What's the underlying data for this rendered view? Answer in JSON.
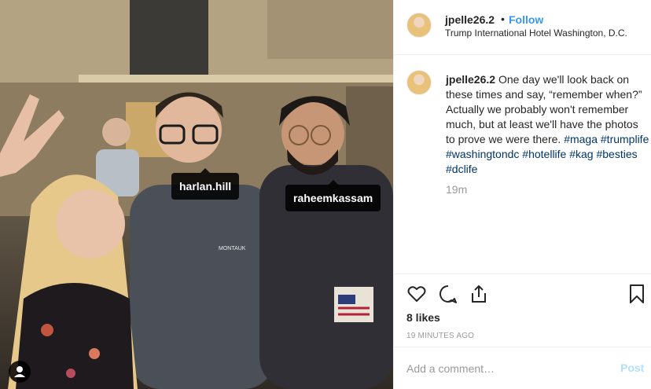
{
  "post": {
    "username": "jpelle26.2",
    "follow_label": "Follow",
    "separator": "•",
    "location": "Trump International Hotel Washington, D.C."
  },
  "caption": {
    "username": "jpelle26.2",
    "text": "One day we'll look back on these times and say, “remember when?” Actually we probably won't remember much, but at least we'll have the photos to prove we were there.",
    "hashtags": [
      "#maga",
      "#trumplife",
      "#washingtondc",
      "#hotellife",
      "#kag",
      "#besties",
      "#dclife"
    ],
    "time_ago": "19m"
  },
  "photo_tags": {
    "first": "harlan.hill",
    "second": "raheemkassam"
  },
  "actions": {
    "likes": "8 likes",
    "timestamp": "19 MINUTES AGO",
    "icons": [
      "heart-icon",
      "comment-icon",
      "share-icon",
      "bookmark-icon"
    ]
  },
  "comment_box": {
    "placeholder": "Add a comment…",
    "post_label": "Post"
  },
  "colors": {
    "link": "#003569",
    "follow": "#3897f0",
    "post_disabled": "#b2dffc",
    "muted": "#999999"
  }
}
